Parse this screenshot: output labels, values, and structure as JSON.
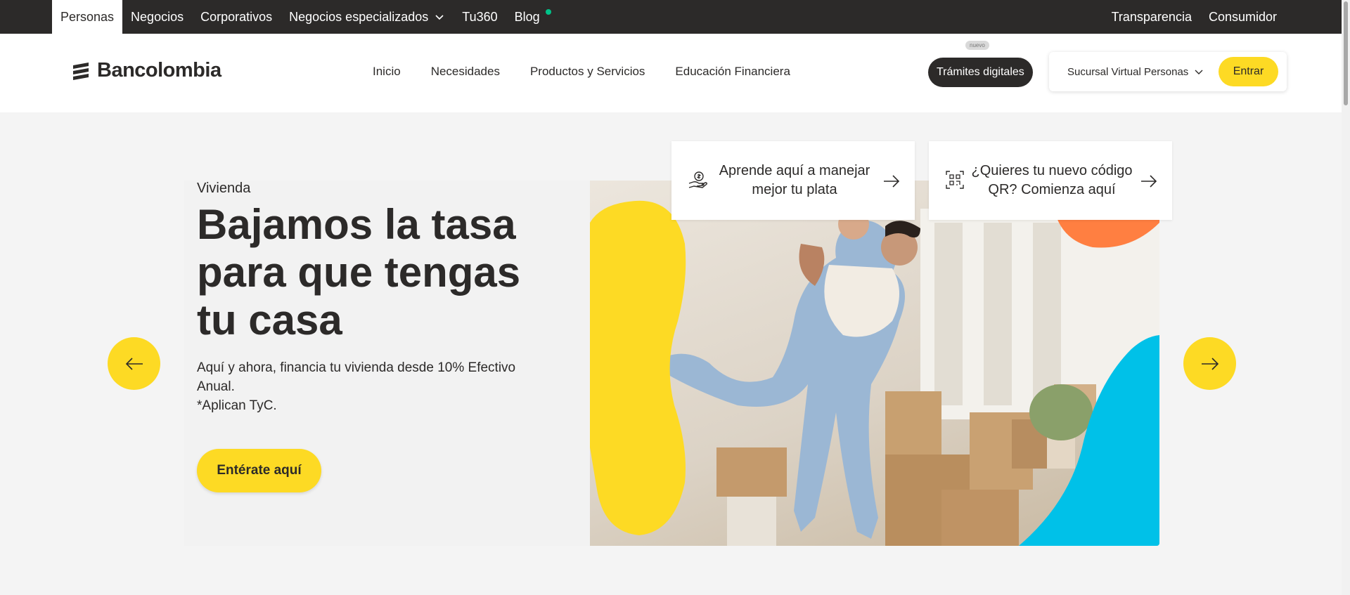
{
  "topbar": {
    "segments": [
      {
        "label": "Personas",
        "active": true
      },
      {
        "label": "Negocios"
      },
      {
        "label": "Corporativos"
      },
      {
        "label": "Negocios especializados",
        "has_dropdown": true
      },
      {
        "label": "Tu360"
      },
      {
        "label": "Blog",
        "indicator_color": "#00c389"
      }
    ],
    "right": [
      {
        "label": "Transparencia"
      },
      {
        "label": "Consumidor"
      }
    ]
  },
  "header": {
    "logo_text": "Bancolombia",
    "nav": [
      "Inicio",
      "Necesidades",
      "Productos y Servicios",
      "Educación Financiera"
    ],
    "badge": "nuevo",
    "tramites_label": "Trámites digitales",
    "login": {
      "select_value": "Sucursal Virtual Personas",
      "entrar_label": "Entrar"
    }
  },
  "info_cards": [
    {
      "text": "Aprende aquí a manejar mejor tu plata",
      "icon": "money-hand-icon"
    },
    {
      "text": "¿Quieres tu nuevo código QR? Comienza aquí",
      "icon": "qr-code-icon"
    }
  ],
  "hero": {
    "eyebrow": "Vivienda",
    "title": "Bajamos la tasa para que tengas tu casa",
    "description_line1": "Aquí y ahora, financia tu vivienda desde 10% Efectivo Anual.",
    "description_line2": "*Aplican TyC.",
    "cta_label": "Entérate aquí",
    "image_alt": "Pareja abrazándose en su nuevo hogar entre cajas de mudanza"
  },
  "colors": {
    "brand_yellow": "#fdda24",
    "dark": "#2c2a29",
    "orange": "#ff7f41",
    "blue": "#00c1e8",
    "green_dot": "#00c389"
  }
}
